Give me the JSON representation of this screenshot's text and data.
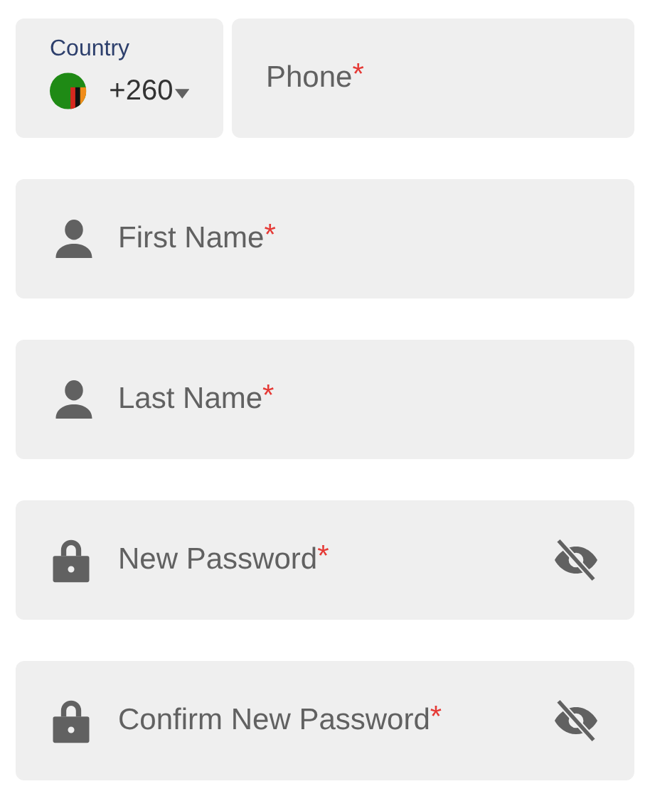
{
  "phone_row": {
    "country": {
      "label": "Country",
      "code": "+260"
    },
    "phone": {
      "placeholder": "Phone",
      "required_mark": "*"
    }
  },
  "fields": [
    {
      "kind": "person",
      "placeholder": "First Name",
      "required_mark": "*"
    },
    {
      "kind": "person",
      "placeholder": "Last Name",
      "required_mark": "*"
    },
    {
      "kind": "password",
      "placeholder": "New Password",
      "required_mark": "*"
    },
    {
      "kind": "password",
      "placeholder": "Confirm New Password",
      "required_mark": "*"
    }
  ]
}
